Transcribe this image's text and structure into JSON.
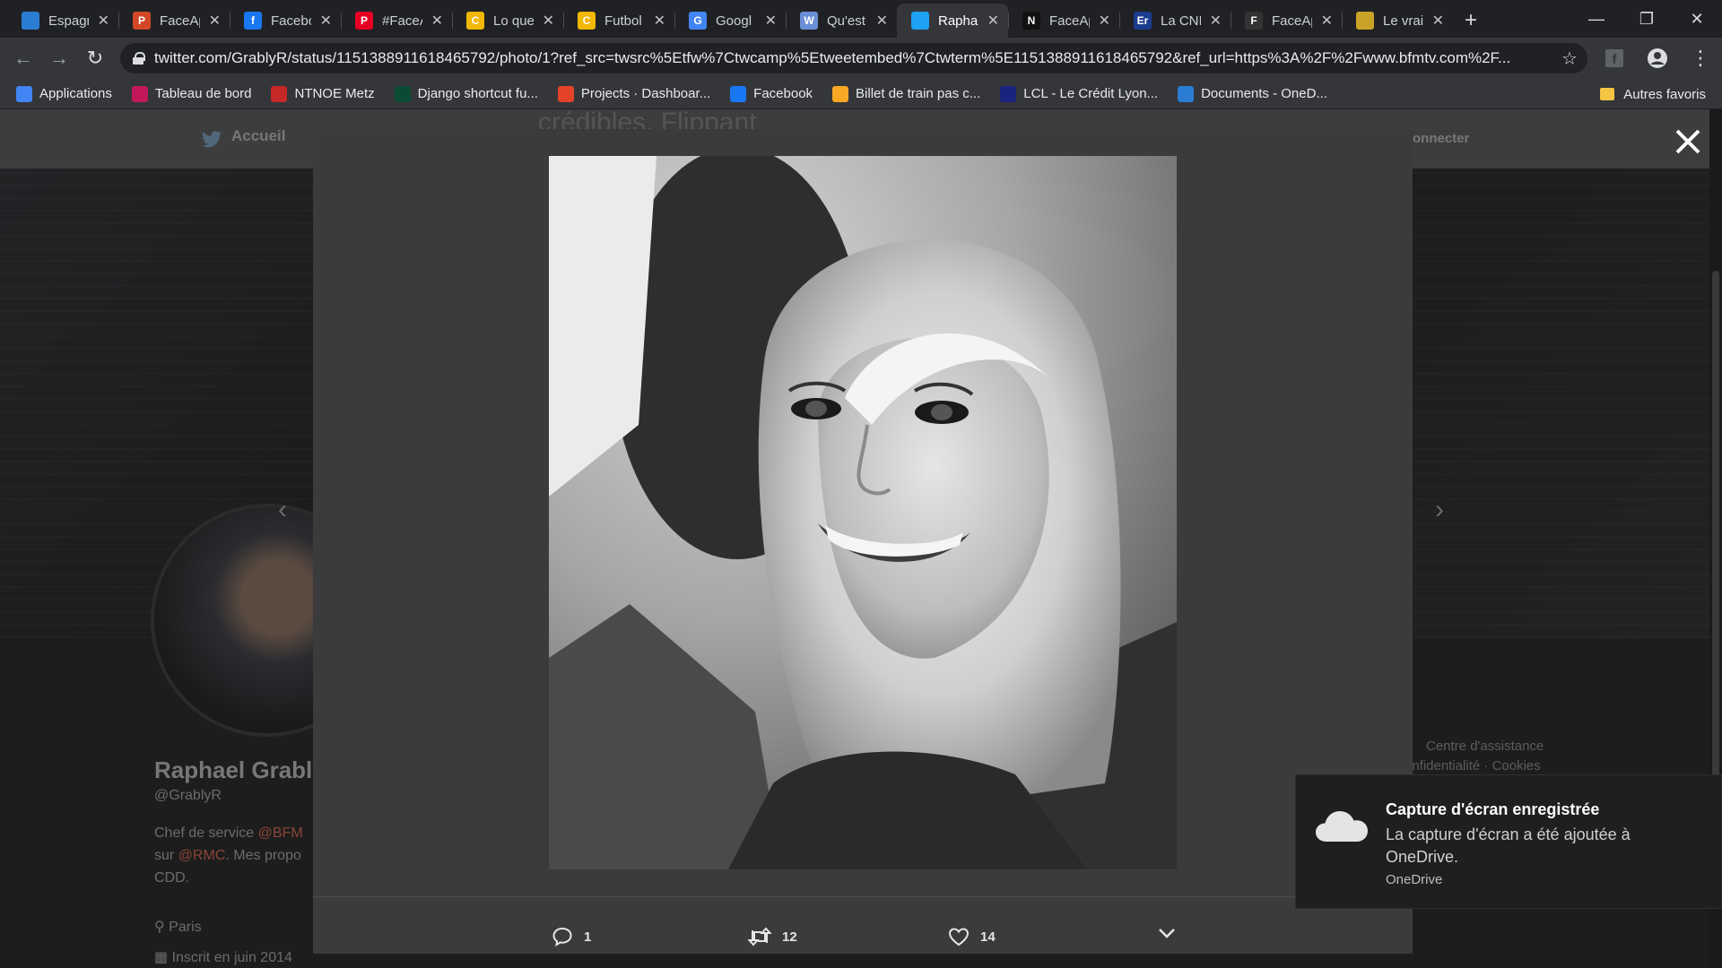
{
  "browser": {
    "tabs": [
      {
        "title": "Espagn",
        "icon": "onedrive-cloud-icon",
        "color": "#2b7cd3",
        "glyph": ""
      },
      {
        "title": "FaceAp",
        "icon": "powerpoint-icon",
        "color": "#d24726",
        "glyph": "P"
      },
      {
        "title": "Facebo",
        "icon": "facebook-icon",
        "color": "#1877f2",
        "glyph": "f"
      },
      {
        "title": "#FaceA",
        "icon": "pinterest-p-icon",
        "color": "#e60023",
        "glyph": "P"
      },
      {
        "title": "Lo que",
        "icon": "yellow-c-icon",
        "color": "#f2b705",
        "glyph": "C"
      },
      {
        "title": "Futbol",
        "icon": "yellow-c-icon",
        "color": "#f2b705",
        "glyph": "C"
      },
      {
        "title": "Googl",
        "icon": "google-translate-icon",
        "color": "#4285f4",
        "glyph": "G"
      },
      {
        "title": "Qu'est",
        "icon": "wm-icon",
        "color": "#6b8fd6",
        "glyph": "W"
      },
      {
        "title": "Raphae",
        "icon": "twitter-bird-icon",
        "color": "#1da1f2",
        "glyph": ""
      },
      {
        "title": "FaceAp",
        "icon": "numerama-icon",
        "color": "#111111",
        "glyph": "N"
      },
      {
        "title": "La CNI",
        "icon": "er-icon",
        "color": "#1b3c8f",
        "glyph": "Er"
      },
      {
        "title": "FaceAp",
        "icon": "f-icon",
        "color": "#333333",
        "glyph": "F"
      },
      {
        "title": "Le vrai",
        "icon": "yellow-icon",
        "color": "#c9a227",
        "glyph": ""
      }
    ],
    "active_tab": 8,
    "url": "twitter.com/GrablyR/status/1151388911618465792/photo/1?ref_src=twsrc%5Etfw%7Ctwcamp%5Etweetembed%7Ctwterm%5E1151388911618465792&ref_url=https%3A%2F%2Fwww.bfmtv.com%2F...",
    "bookmarks": [
      {
        "label": "Applications",
        "icon": "apps-grid-icon",
        "color": "#4285f4"
      },
      {
        "label": "Tableau de bord",
        "icon": "dashboard-icon",
        "color": "#c2185b"
      },
      {
        "label": "NTNOE Metz",
        "icon": "ntnoe-icon",
        "color": "#c62828"
      },
      {
        "label": "Django shortcut fu...",
        "icon": "django-icon",
        "color": "#0c4b33"
      },
      {
        "label": "Projects · Dashboar...",
        "icon": "gitlab-icon",
        "color": "#e24329"
      },
      {
        "label": "Facebook",
        "icon": "facebook-icon",
        "color": "#1877f2"
      },
      {
        "label": "Billet de train pas c...",
        "icon": "train-ticket-icon",
        "color": "#f9a825"
      },
      {
        "label": "LCL - Le Crédit Lyon...",
        "icon": "lcl-icon",
        "color": "#1a237e"
      },
      {
        "label": "Documents - OneD...",
        "icon": "onedrive-cloud-icon",
        "color": "#2b7cd3"
      }
    ],
    "other_bookmarks": "Autres favoris"
  },
  "background_page": {
    "nav_home": "Accueil",
    "nav_connect": "onnecter",
    "profile_name": "Raphael Grably",
    "profile_handle": "@GrablyR",
    "bio_line1": "Chef de service",
    "bio_mention1": "@BFM",
    "bio_line2": "sur",
    "bio_mention2": "@RMC",
    "bio_line3": ". Mes propo",
    "bio_line4": "CDD.",
    "location": "Paris",
    "joined": "Inscrit en juin 2014",
    "footer_link1": "Centre d'assistance",
    "footer_link2": "onfidentialité",
    "footer_link3": "Cookies",
    "partial_heading": "crédibles. Flippant"
  },
  "modal": {
    "actions": {
      "replies": "1",
      "retweets": "12",
      "likes": "14"
    }
  },
  "toast": {
    "title": "Capture d'écran enregistrée",
    "body": "La capture d'écran a été ajoutée à OneDrive.",
    "source": "OneDrive"
  }
}
